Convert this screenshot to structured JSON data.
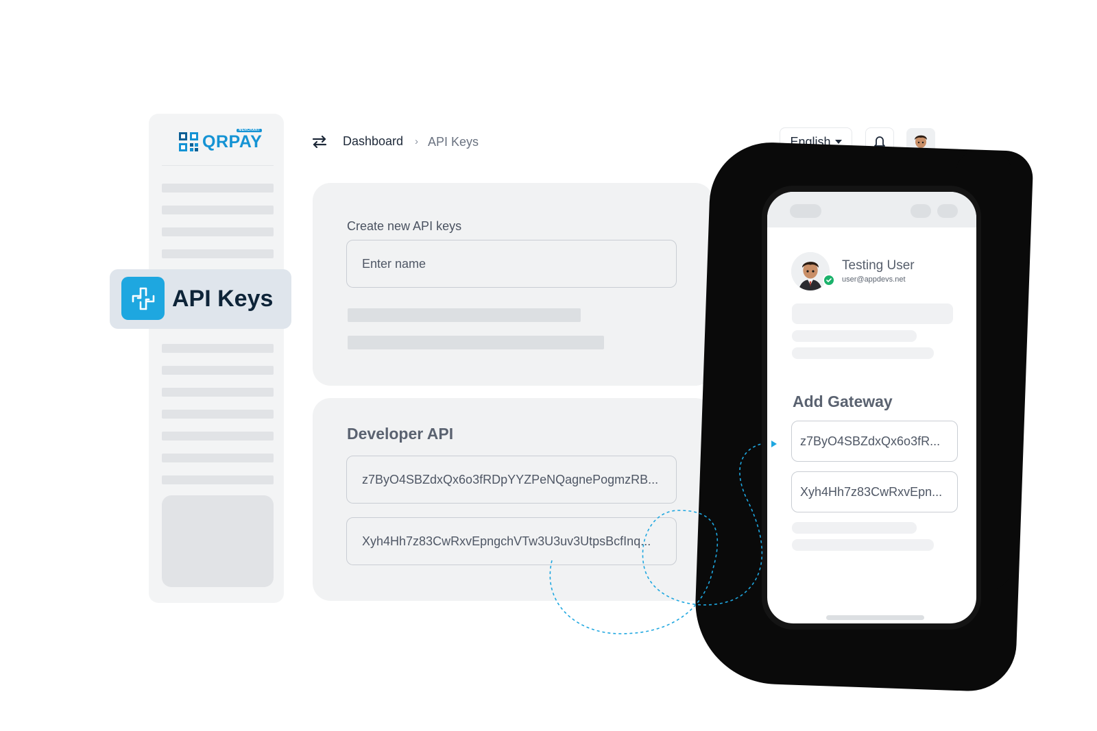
{
  "app": {
    "logo_text": "QRPAY",
    "logo_sub": "MERCHANT",
    "accent_color": "#1ea7e0",
    "brand_color": "#1593d4"
  },
  "sidebar": {
    "active_item": {
      "label": "API Keys",
      "icon": "api-keys-icon"
    }
  },
  "header": {
    "menu_toggle_icon": "swap-arrows-icon",
    "breadcrumb": {
      "home": "Dashboard",
      "separator": "›",
      "current": "API Keys"
    },
    "language": {
      "selected": "English"
    },
    "notification_icon": "bell-icon",
    "user_avatar": "user-avatar"
  },
  "create_panel": {
    "label": "Create new API keys",
    "name_input": {
      "placeholder": "Enter name",
      "value": ""
    }
  },
  "developer_panel": {
    "title": "Developer API",
    "keys": [
      "z7ByO4SBZdxQx6o3fRDpYYZPeNQagnePogmzRB...",
      "Xyh4Hh7z83CwRxvEpngchVTw3U3uv3UtpsBcfInq..."
    ]
  },
  "phone": {
    "user": {
      "name": "Testing User",
      "email": "user@appdevs.net",
      "verified_icon": "check-icon"
    },
    "gateway_title": "Add Gateway",
    "gateway_keys": [
      "z7ByO4SBZdxQx6o3fR...",
      "Xyh4Hh7z83CwRxvEpn..."
    ]
  }
}
